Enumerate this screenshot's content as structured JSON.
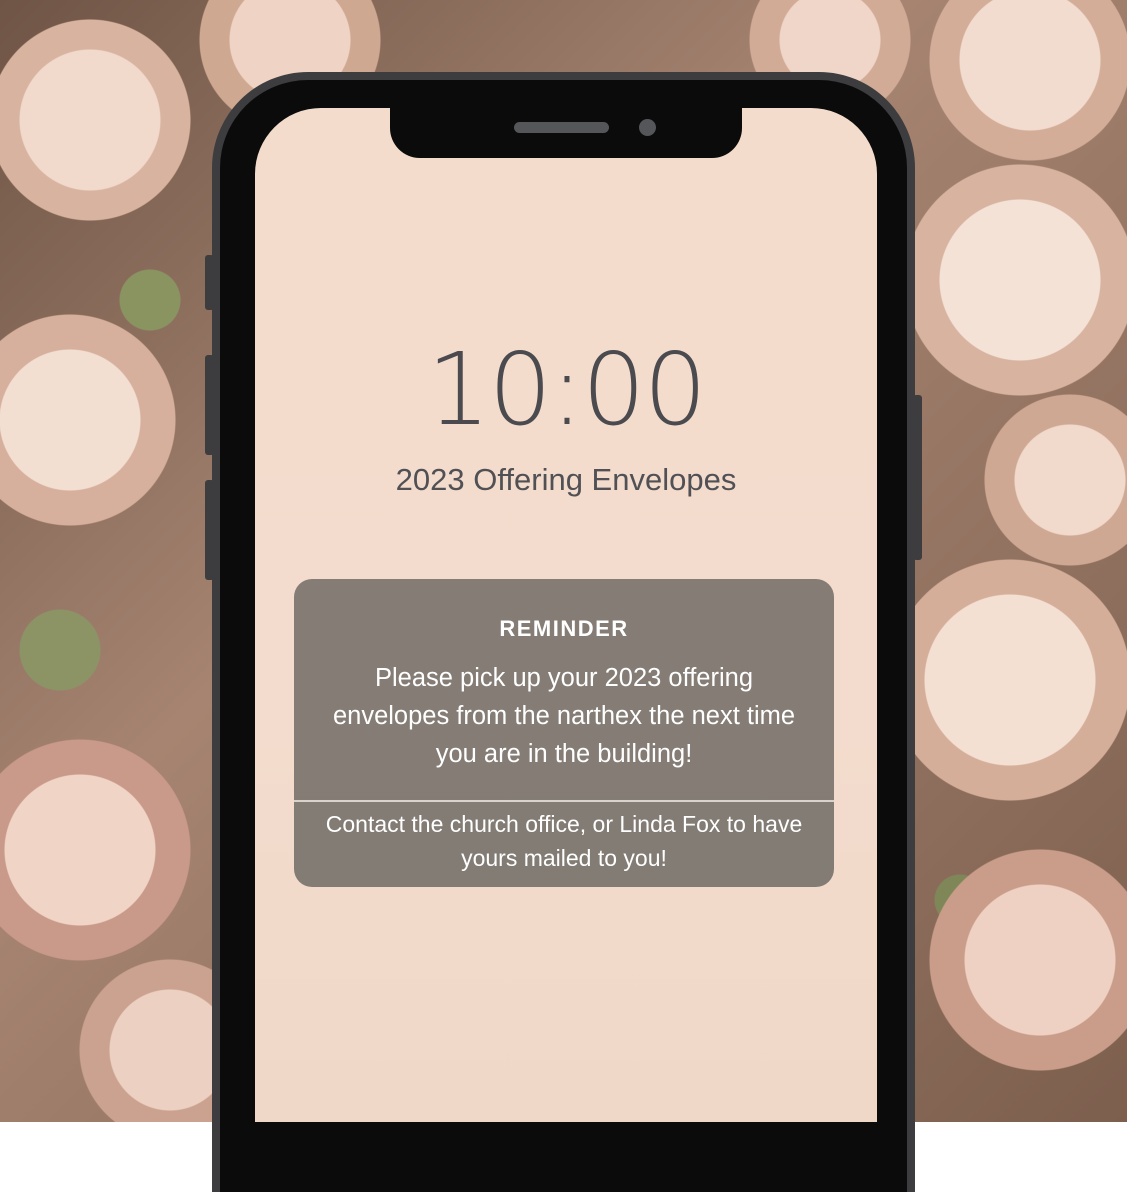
{
  "lockscreen": {
    "time": "10:00",
    "title": "2023 Offering Envelopes"
  },
  "notification": {
    "heading": "REMINDER",
    "body": "Please pick up your 2023 offering envelopes from the narthex the next time you are in the building!",
    "footer": "Contact the church office, or Linda Fox to have yours mailed to you!"
  },
  "colors": {
    "screen": "#f4dccd",
    "card": "#7b746e",
    "card_text": "#ffffff",
    "clock_text": "#4b4b4f",
    "phone_frame": "#3d3d3f"
  }
}
